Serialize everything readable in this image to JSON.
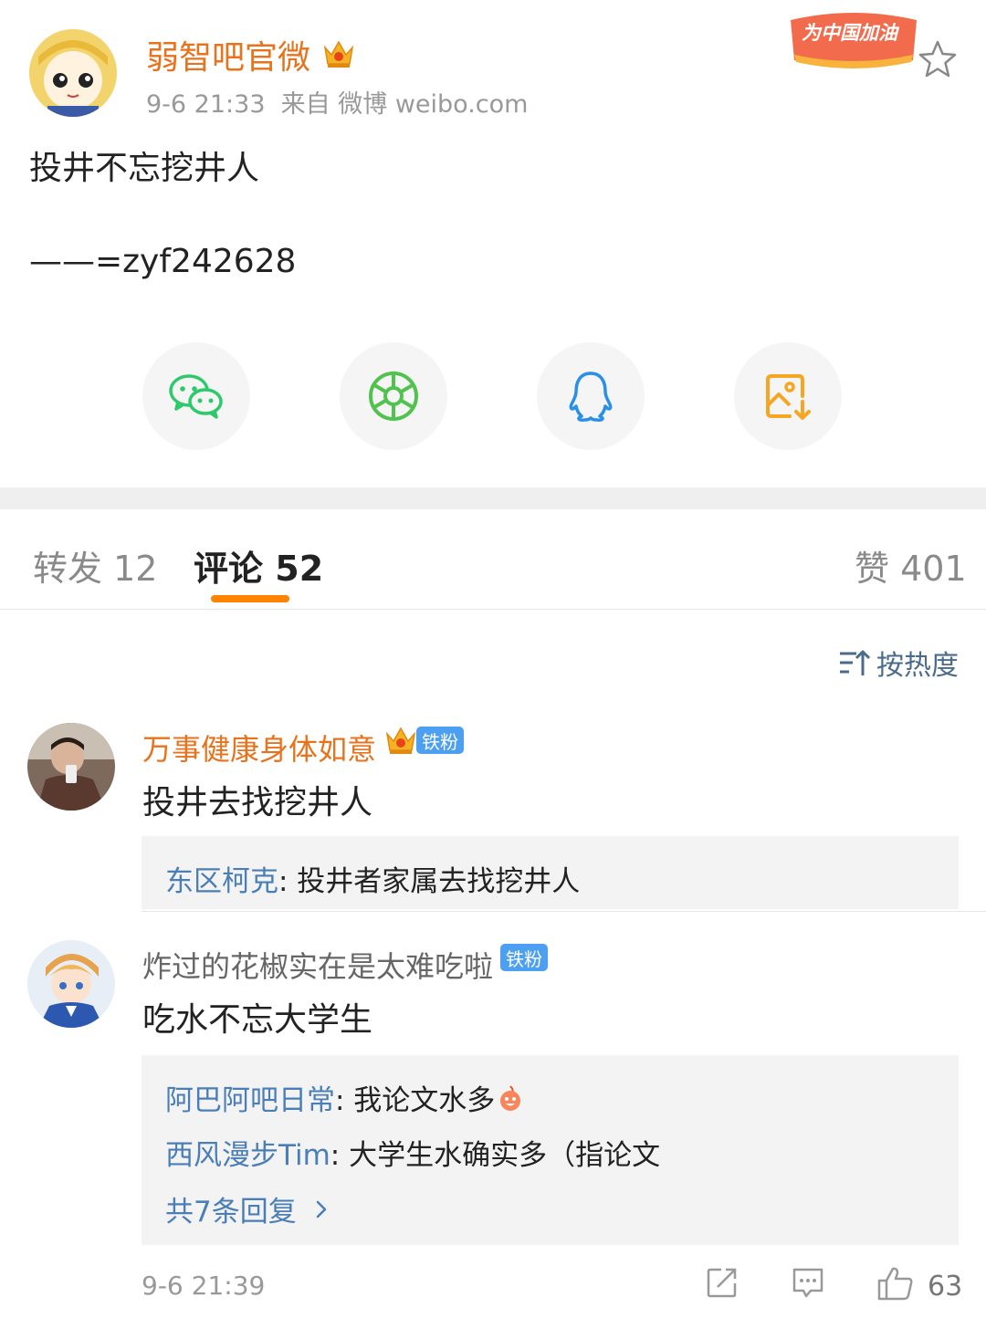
{
  "post": {
    "author": "弱智吧官微",
    "time": "9-6 21:33",
    "source": "来自 微博 weibo.com",
    "text_line1": "投井不忘挖井人",
    "text_line2": "——=zyf242628",
    "promo_badge_text": "为中国加油"
  },
  "share": {
    "items": [
      {
        "icon": "wechat-icon"
      },
      {
        "icon": "moments-icon"
      },
      {
        "icon": "qq-icon"
      },
      {
        "icon": "save-image-icon"
      }
    ]
  },
  "tabs": {
    "repost_label": "转发",
    "repost_count": "12",
    "comment_label": "评论",
    "comment_count": "52",
    "like_label": "赞",
    "like_count": "401"
  },
  "sort": {
    "label": "按热度"
  },
  "comments": [
    {
      "name": "万事健康身体如意",
      "badge": "铁粉",
      "text": "投井去找挖井人",
      "replies": [
        {
          "name": "东区柯克",
          "text": ": 投井者家属去找挖井人"
        }
      ]
    },
    {
      "name": "炸过的花椒实在是太难吃啦",
      "badge": "铁粉",
      "text": "吃水不忘大学生",
      "replies": [
        {
          "name": "阿巴阿吧日常",
          "text": ": 我论文水多"
        },
        {
          "name": "西风漫步Tim",
          "text": ": 大学生水确实多（指论文"
        }
      ],
      "more_replies": "共7条回复",
      "time": "9-6 21:39",
      "likes": "63"
    }
  ],
  "colors": {
    "accent_orange": "#ff8200",
    "name_orange": "#e8731c",
    "link_blue": "#4a7eb7",
    "wechat_green": "#2ec96a",
    "fan_badge_blue": "#4d9ff1"
  }
}
